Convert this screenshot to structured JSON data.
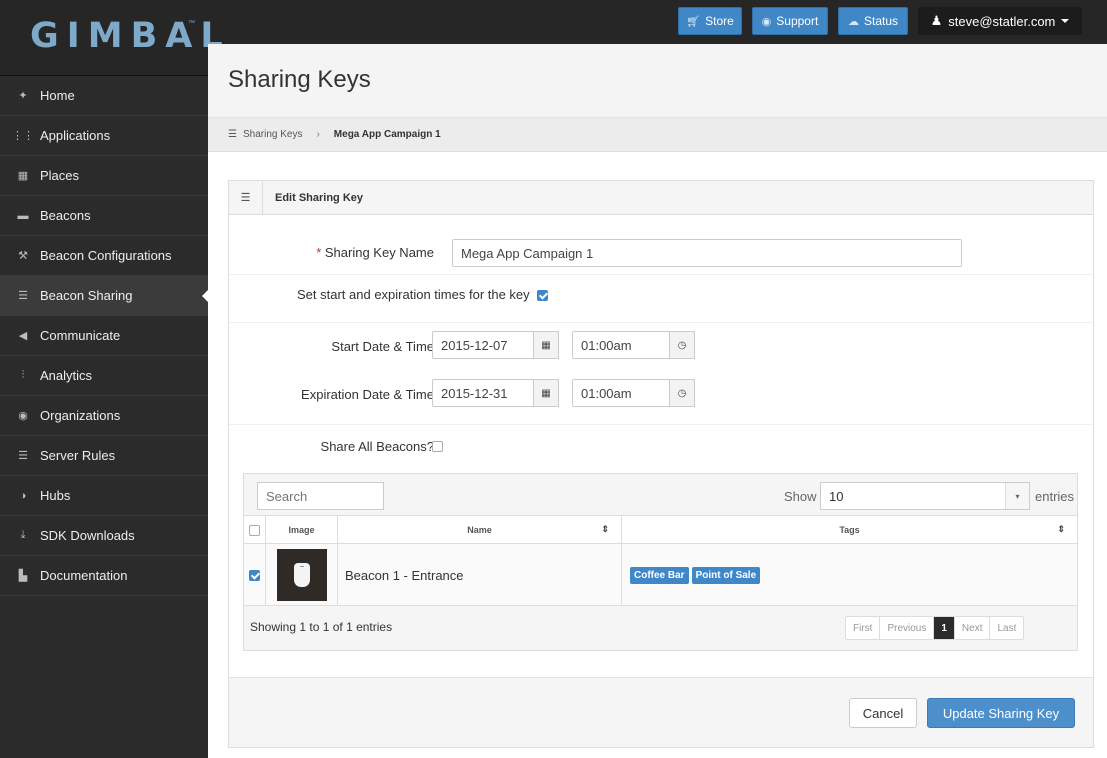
{
  "brand": {
    "logo_text": "GIMBAL",
    "logo_tm": "™"
  },
  "topbar": {
    "store": {
      "label": "Store",
      "icon": "cart-icon"
    },
    "support": {
      "label": "Support",
      "icon": "lifebuoy-icon"
    },
    "status": {
      "label": "Status",
      "icon": "cloud-icon"
    },
    "user": {
      "label": "steve@statler.com",
      "icon": "user-icon"
    },
    "accent": "#3f87c7"
  },
  "sidebar": {
    "items": [
      {
        "label": "Home",
        "icon": "home-icon",
        "glyph": "✦"
      },
      {
        "label": "Applications",
        "icon": "grid-icon",
        "glyph": "⋮⋮"
      },
      {
        "label": "Places",
        "icon": "image-icon",
        "glyph": "▦"
      },
      {
        "label": "Beacons",
        "icon": "beacon-icon",
        "glyph": "▬"
      },
      {
        "label": "Beacon Configurations",
        "icon": "wrench-icon",
        "glyph": "⚒"
      },
      {
        "label": "Beacon Sharing",
        "icon": "list-icon",
        "glyph": "☰",
        "active": true
      },
      {
        "label": "Communicate",
        "icon": "megaphone-icon",
        "glyph": "◀"
      },
      {
        "label": "Analytics",
        "icon": "chart-icon",
        "glyph": "⫶"
      },
      {
        "label": "Organizations",
        "icon": "globe-icon",
        "glyph": "◉"
      },
      {
        "label": "Server Rules",
        "icon": "list-icon",
        "glyph": "☰"
      },
      {
        "label": "Hubs",
        "icon": "contrast-icon",
        "glyph": "◑"
      },
      {
        "label": "SDK Downloads",
        "icon": "download-icon",
        "glyph": "⤓"
      },
      {
        "label": "Documentation",
        "icon": "document-icon",
        "glyph": "▙"
      }
    ]
  },
  "page": {
    "title": "Sharing Keys"
  },
  "breadcrumb": {
    "root": "Sharing Keys",
    "current": "Mega App Campaign 1"
  },
  "panel": {
    "title": "Edit Sharing Key"
  },
  "form": {
    "name_label": "Sharing Key Name",
    "name_required_mark": "*",
    "name_value": "Mega App Campaign 1",
    "set_times_label": "Set start and expiration times for the key",
    "set_times_checked": true,
    "start_label": "Start Date & Time",
    "start_date": "2015-12-07",
    "start_time": "01:00am",
    "expiration_label": "Expiration Date & Time",
    "expiration_date": "2015-12-31",
    "expiration_time": "01:00am",
    "share_all_label": "Share All Beacons?",
    "share_all_checked": false
  },
  "table": {
    "search_placeholder": "Search",
    "show_label": "Show",
    "show_value": "10",
    "entries_label": "entries",
    "columns": {
      "image": "Image",
      "name": "Name",
      "tags": "Tags"
    },
    "rows": [
      {
        "checked": true,
        "name": "Beacon 1 - Entrance",
        "tags": [
          "Coffee Bar",
          "Point of Sale"
        ]
      }
    ],
    "summary": "Showing 1 to 1 of 1 entries",
    "pager": {
      "first": "First",
      "previous": "Previous",
      "current": "1",
      "next": "Next",
      "last": "Last"
    }
  },
  "actions": {
    "cancel": "Cancel",
    "update": "Update Sharing Key"
  }
}
